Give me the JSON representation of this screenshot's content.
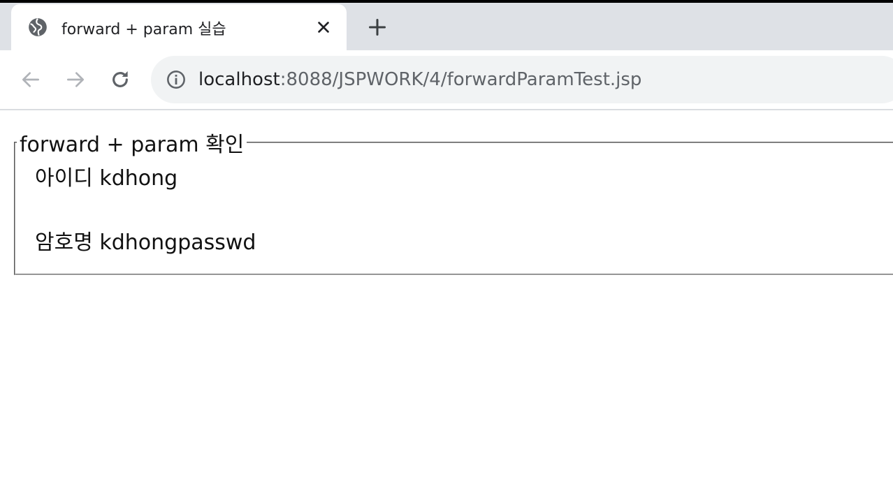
{
  "tab": {
    "title": "forward + param 실습",
    "globe_icon": "globe-icon",
    "close_icon": "close-icon"
  },
  "new_tab_icon": "plus-icon",
  "toolbar": {
    "back_icon": "arrow-left-icon",
    "forward_icon": "arrow-right-icon",
    "reload_icon": "reload-icon",
    "info_icon": "info-icon",
    "url_host": "localhost",
    "url_rest": ":8088/JSPWORK/4/forwardParamTest.jsp"
  },
  "page": {
    "legend": "forward + param 확인",
    "id_label": "아이디",
    "id_value": "kdhong",
    "pw_label": "암호명",
    "pw_value": "kdhongpasswd"
  },
  "colors": {
    "tabstrip": "#dee1e6",
    "omnibox": "#f1f3f4",
    "icon": "#5f6368"
  }
}
